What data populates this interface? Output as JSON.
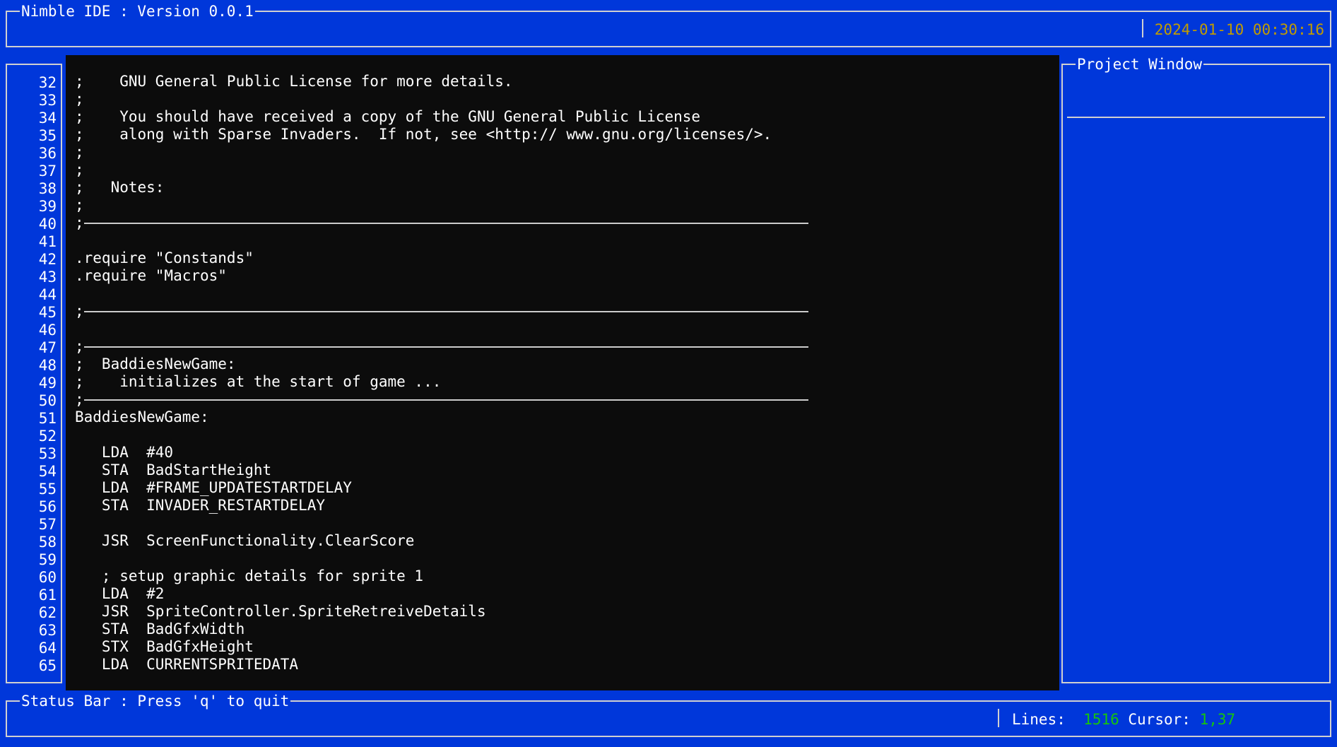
{
  "header": {
    "title": "Nimble IDE : Version 0.0.1",
    "datetime": "2024-01-10 00:30:16"
  },
  "gutter": {
    "line_numbers": [
      "32",
      "33",
      "34",
      "35",
      "36",
      "37",
      "38",
      "39",
      "40",
      "41",
      "42",
      "43",
      "44",
      "45",
      "46",
      "47",
      "48",
      "49",
      "50",
      "51",
      "52",
      "53",
      "54",
      "55",
      "56",
      "57",
      "58",
      "59",
      "60",
      "61",
      "62",
      "63",
      "64",
      "65"
    ]
  },
  "editor": {
    "lines": [
      ";    GNU General Public License for more details.",
      ";",
      ";    You should have received a copy of the GNU General Public License",
      ";    along with Sparse Invaders.  If not, see <http:// www.gnu.org/licenses/>.",
      ";",
      ";",
      ";   Notes:",
      ";",
      ";",
      "",
      ".require \"Constands\"",
      ".require \"Macros\"",
      "",
      ";",
      "",
      ";",
      ";  BaddiesNewGame:",
      ";    initializes at the start of game ...",
      ";",
      "BaddiesNewGame:",
      "",
      "   LDA  #40",
      "   STA  BadStartHeight",
      "   LDA  #FRAME_UPDATESTARTDELAY",
      "   STA  INVADER_RESTARTDELAY",
      "",
      "   JSR  ScreenFunctionality.ClearScore",
      "",
      "   ; setup graphic details for sprite 1",
      "   LDA  #2",
      "   JSR  SpriteController.SpriteRetreiveDetails",
      "   STA  BadGfxWidth",
      "   STX  BadGfxHeight",
      "   LDA  CURRENTSPRITEDATA"
    ]
  },
  "project_window": {
    "title": "Project Window"
  },
  "status_bar": {
    "title": "Status Bar : Press 'q' to quit",
    "lines_label": "Lines:",
    "lines_value": "1516",
    "cursor_label": "Cursor:",
    "cursor_value": "1,37"
  },
  "colors": {
    "background": "#0037da",
    "editor_bg": "#0c0c0c",
    "clock": "#c19c00",
    "status_value": "#16c60c"
  }
}
